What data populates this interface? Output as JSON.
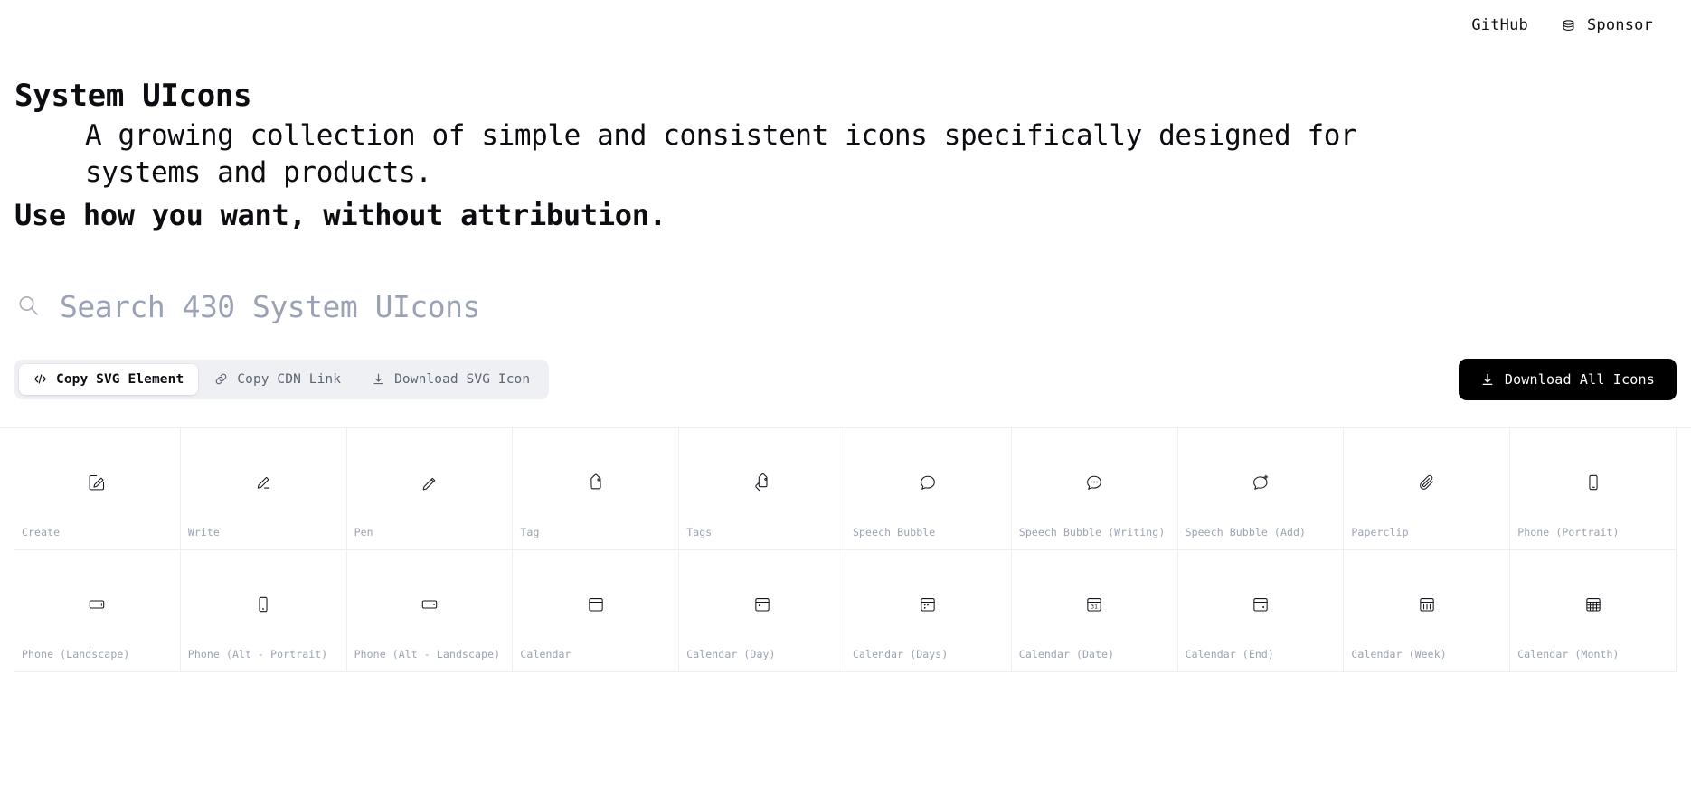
{
  "nav": {
    "links": [
      {
        "label": "GitHub",
        "icon": ""
      },
      {
        "label": "Sponsor",
        "icon": "coins-icon"
      }
    ]
  },
  "hero": {
    "title": "System UIcons",
    "subtitle": "A growing collection of simple and consistent icons specifically designed for systems and products.",
    "footer": "Use how you want, without attribution."
  },
  "search": {
    "placeholder": "Search 430 System UIcons",
    "value": "",
    "icon": "search-icon",
    "count": 430
  },
  "toolbar": {
    "segments": [
      {
        "label": "Copy SVG Element",
        "icon": "code-icon",
        "active": true
      },
      {
        "label": "Copy CDN Link",
        "icon": "link-icon",
        "active": false
      },
      {
        "label": "Download SVG Icon",
        "icon": "download-icon",
        "active": false
      }
    ],
    "download_all": {
      "label": "Download All Icons",
      "icon": "download-icon"
    }
  },
  "grid": {
    "icons": [
      {
        "label": "Create",
        "glyph": "create-icon"
      },
      {
        "label": "Write",
        "glyph": "write-icon"
      },
      {
        "label": "Pen",
        "glyph": "pen-icon"
      },
      {
        "label": "Tag",
        "glyph": "tag-icon"
      },
      {
        "label": "Tags",
        "glyph": "tags-icon"
      },
      {
        "label": "Speech Bubble",
        "glyph": "speech-bubble-icon"
      },
      {
        "label": "Speech Bubble (Writing)",
        "glyph": "speech-bubble-writing-icon"
      },
      {
        "label": "Speech Bubble (Add)",
        "glyph": "speech-bubble-add-icon"
      },
      {
        "label": "Paperclip",
        "glyph": "paperclip-icon"
      },
      {
        "label": "Phone (Portrait)",
        "glyph": "phone-portrait-icon"
      },
      {
        "label": "Phone (Landscape)",
        "glyph": "phone-landscape-icon"
      },
      {
        "label": "Phone (Alt - Portrait)",
        "glyph": "phone-alt-portrait-icon"
      },
      {
        "label": "Phone (Alt - Landscape)",
        "glyph": "phone-alt-landscape-icon"
      },
      {
        "label": "Calendar",
        "glyph": "calendar-icon"
      },
      {
        "label": "Calendar (Day)",
        "glyph": "calendar-day-icon"
      },
      {
        "label": "Calendar (Days)",
        "glyph": "calendar-days-icon"
      },
      {
        "label": "Calendar (Date)",
        "glyph": "calendar-date-icon",
        "day": "31"
      },
      {
        "label": "Calendar (End)",
        "glyph": "calendar-end-icon"
      },
      {
        "label": "Calendar (Week)",
        "glyph": "calendar-week-icon"
      },
      {
        "label": "Calendar (Month)",
        "glyph": "calendar-month-icon"
      }
    ]
  },
  "colors": {
    "text": "#0b0d11",
    "muted": "#9aa2b4",
    "border": "#eceef2",
    "segment_bg": "#eef0f4",
    "accent": "#000000"
  }
}
